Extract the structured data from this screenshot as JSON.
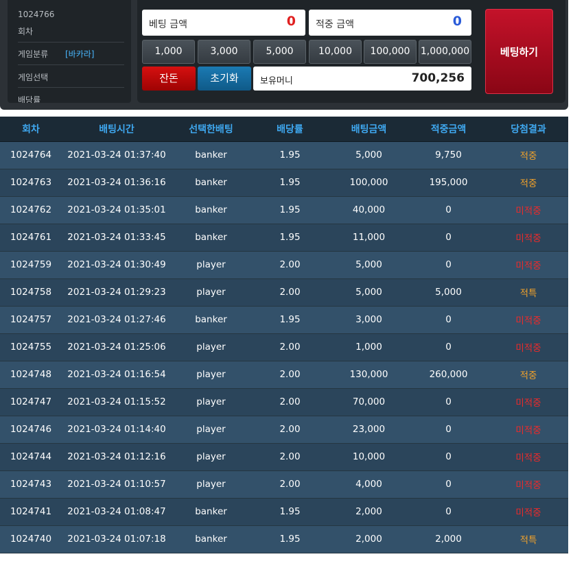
{
  "info": {
    "round_number": "1024766",
    "round_label": "회차",
    "game_kind_label": "게임분류",
    "game_kind_value": "[바카라]",
    "game_select_label": "게임선택",
    "odds_label": "배당률"
  },
  "bet_panel": {
    "bet_amount_label": "베팅 금액",
    "bet_amount_value": "0",
    "win_amount_label": "적중 금액",
    "win_amount_value": "0",
    "chips": [
      "1,000",
      "3,000",
      "5,000",
      "10,000",
      "100,000",
      "1,000,000"
    ],
    "change_label": "잔돈",
    "reset_label": "초기화",
    "balance_label": "보유머니",
    "balance_value": "700,256",
    "bet_button_label": "베팅하기"
  },
  "colors": {
    "win": "#f2a22a",
    "lose": "#ee2a2a",
    "header_text": "#3fa8f0"
  },
  "table": {
    "headers": [
      "회차",
      "배팅시간",
      "선택한배팅",
      "배당률",
      "배팅금액",
      "적중금액",
      "당첨결과"
    ],
    "rows": [
      {
        "round": "1024764",
        "time": "2021-03-24 01:37:40",
        "pick": "banker",
        "odds": "1.95",
        "bet": "5,000",
        "payout": "9,750",
        "result": "적중",
        "status": "win"
      },
      {
        "round": "1024763",
        "time": "2021-03-24 01:36:16",
        "pick": "banker",
        "odds": "1.95",
        "bet": "100,000",
        "payout": "195,000",
        "result": "적중",
        "status": "win"
      },
      {
        "round": "1024762",
        "time": "2021-03-24 01:35:01",
        "pick": "banker",
        "odds": "1.95",
        "bet": "40,000",
        "payout": "0",
        "result": "미적중",
        "status": "lose"
      },
      {
        "round": "1024761",
        "time": "2021-03-24 01:33:45",
        "pick": "banker",
        "odds": "1.95",
        "bet": "11,000",
        "payout": "0",
        "result": "미적중",
        "status": "lose"
      },
      {
        "round": "1024759",
        "time": "2021-03-24 01:30:49",
        "pick": "player",
        "odds": "2.00",
        "bet": "5,000",
        "payout": "0",
        "result": "미적중",
        "status": "lose"
      },
      {
        "round": "1024758",
        "time": "2021-03-24 01:29:23",
        "pick": "player",
        "odds": "2.00",
        "bet": "5,000",
        "payout": "5,000",
        "result": "적특",
        "status": "win"
      },
      {
        "round": "1024757",
        "time": "2021-03-24 01:27:46",
        "pick": "banker",
        "odds": "1.95",
        "bet": "3,000",
        "payout": "0",
        "result": "미적중",
        "status": "lose"
      },
      {
        "round": "1024755",
        "time": "2021-03-24 01:25:06",
        "pick": "player",
        "odds": "2.00",
        "bet": "1,000",
        "payout": "0",
        "result": "미적중",
        "status": "lose"
      },
      {
        "round": "1024748",
        "time": "2021-03-24 01:16:54",
        "pick": "player",
        "odds": "2.00",
        "bet": "130,000",
        "payout": "260,000",
        "result": "적중",
        "status": "win"
      },
      {
        "round": "1024747",
        "time": "2021-03-24 01:15:52",
        "pick": "player",
        "odds": "2.00",
        "bet": "70,000",
        "payout": "0",
        "result": "미적중",
        "status": "lose"
      },
      {
        "round": "1024746",
        "time": "2021-03-24 01:14:40",
        "pick": "player",
        "odds": "2.00",
        "bet": "23,000",
        "payout": "0",
        "result": "미적중",
        "status": "lose"
      },
      {
        "round": "1024744",
        "time": "2021-03-24 01:12:16",
        "pick": "player",
        "odds": "2.00",
        "bet": "10,000",
        "payout": "0",
        "result": "미적중",
        "status": "lose"
      },
      {
        "round": "1024743",
        "time": "2021-03-24 01:10:57",
        "pick": "player",
        "odds": "2.00",
        "bet": "4,000",
        "payout": "0",
        "result": "미적중",
        "status": "lose"
      },
      {
        "round": "1024741",
        "time": "2021-03-24 01:08:47",
        "pick": "banker",
        "odds": "1.95",
        "bet": "2,000",
        "payout": "0",
        "result": "미적중",
        "status": "lose"
      },
      {
        "round": "1024740",
        "time": "2021-03-24 01:07:18",
        "pick": "banker",
        "odds": "1.95",
        "bet": "2,000",
        "payout": "2,000",
        "result": "적특",
        "status": "win"
      }
    ]
  }
}
